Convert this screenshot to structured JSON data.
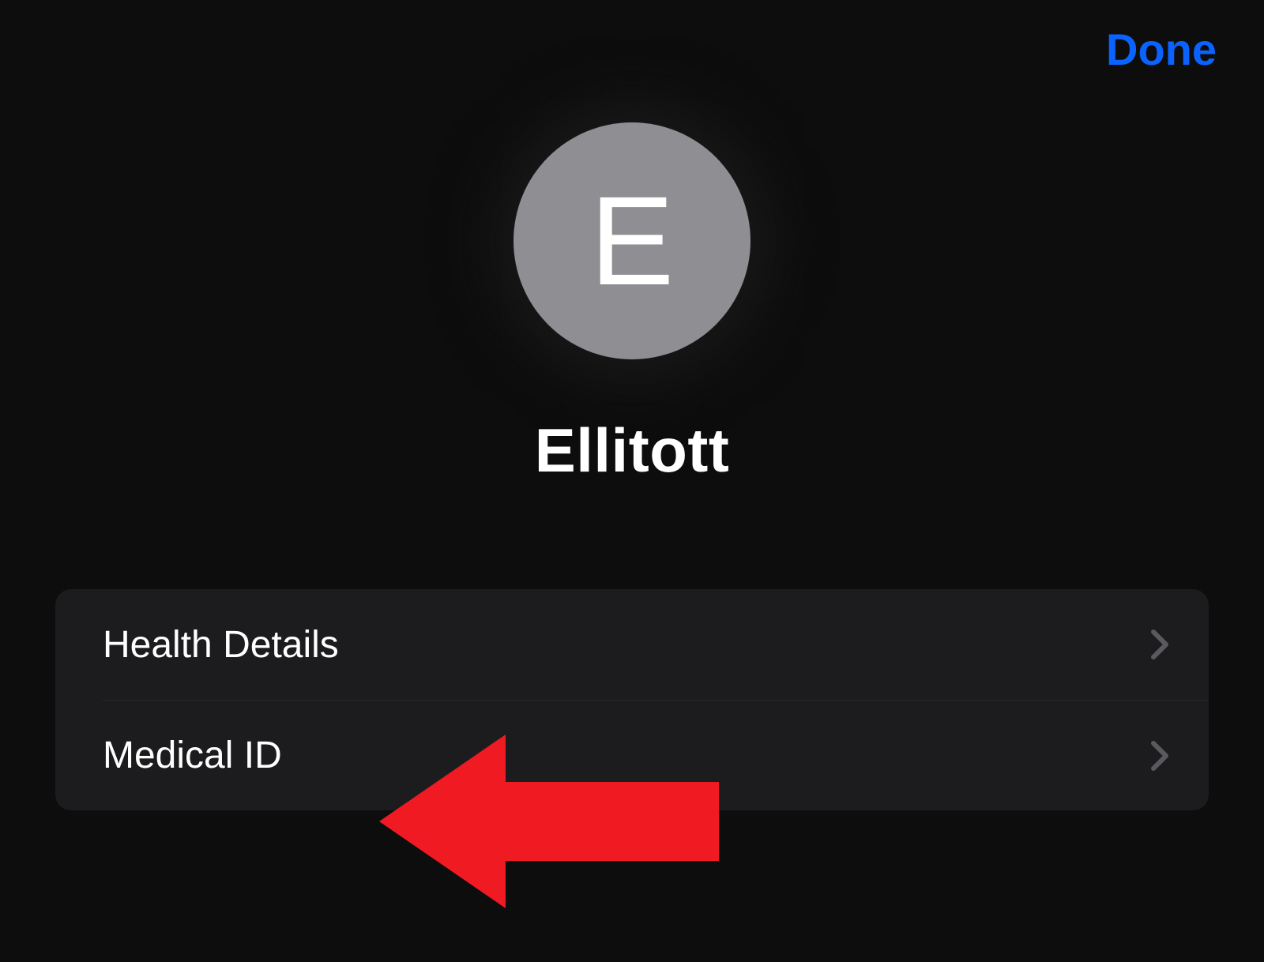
{
  "header": {
    "done_label": "Done"
  },
  "profile": {
    "avatar_initial": "E",
    "name": "Ellitott"
  },
  "menu": {
    "items": [
      {
        "label": "Health Details"
      },
      {
        "label": "Medical ID"
      }
    ]
  },
  "colors": {
    "background": "#0d0d0d",
    "cell": "#1c1c1e",
    "accent": "#0b63ff",
    "avatar": "#8e8e93",
    "annotation": "#f01a23"
  }
}
